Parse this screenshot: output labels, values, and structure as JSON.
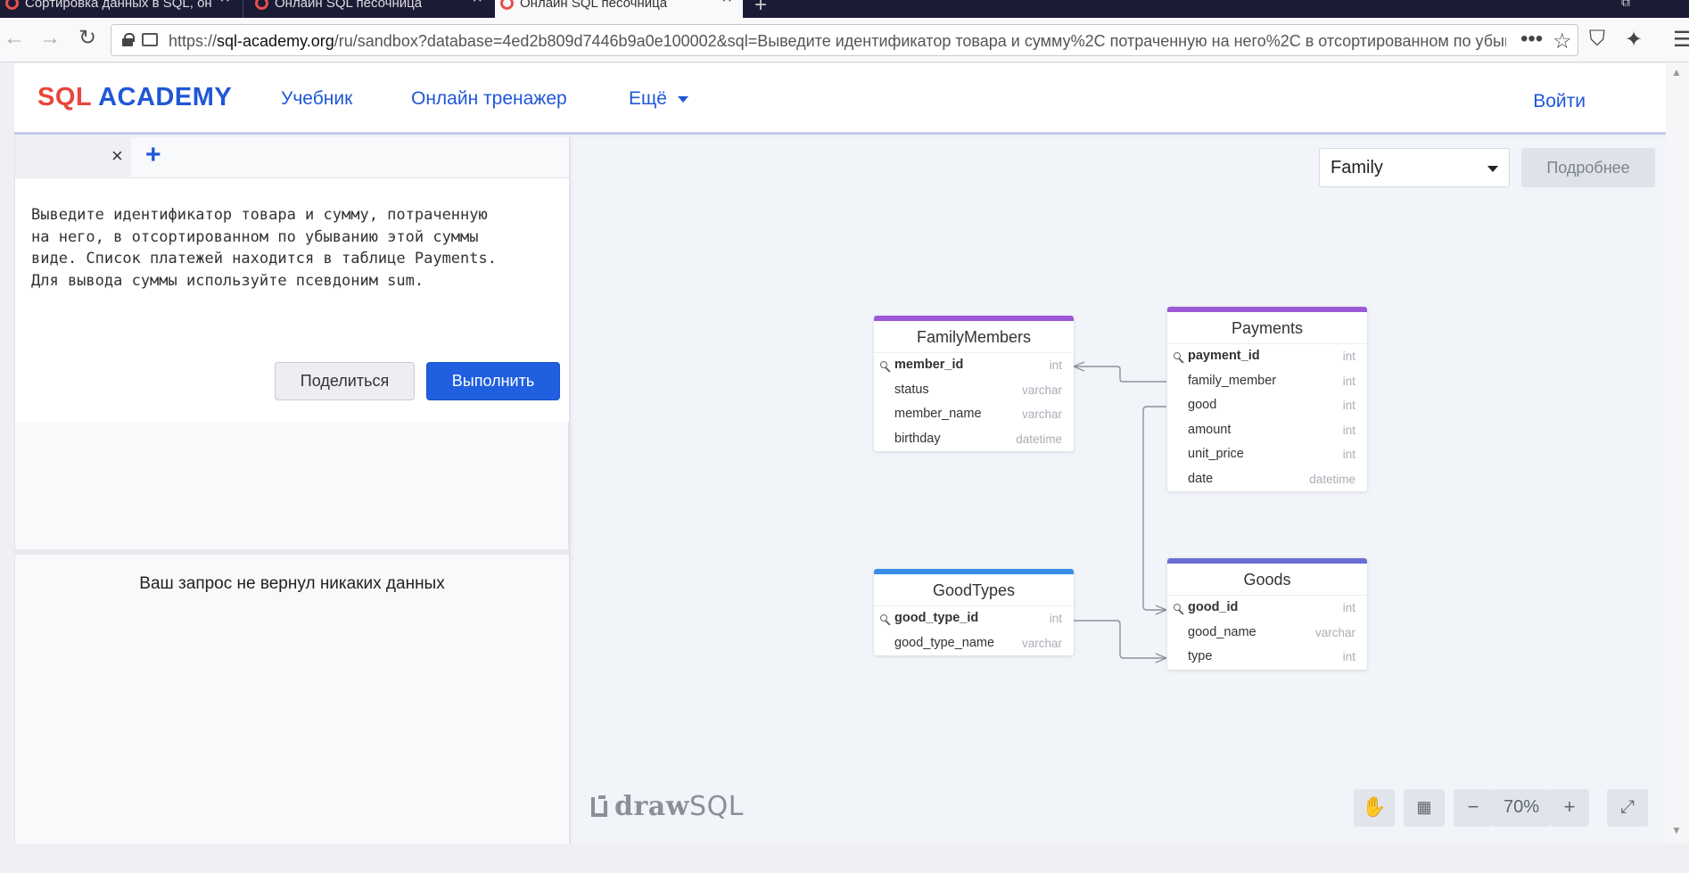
{
  "browser": {
    "tabs": [
      {
        "title": "Сортировка данных в SQL, он"
      },
      {
        "title": "Онлайн SQL песочница"
      },
      {
        "title": "Онлайн SQL песочница"
      }
    ],
    "url_prefix": "https://",
    "url_domain": "sql-academy.org",
    "url_rest": "/ru/sandbox?database=4ed2b809d7446b9a0e100002&sql=Выведите идентификатор товара и сумму%2C потраченную на него%2C в отсортированном по убыванию эт"
  },
  "site": {
    "logo_sql": "SQL",
    "logo_academy": "ACADEMY",
    "menu": {
      "tutorial": "Учебник",
      "trainer": "Онлайн тренажер",
      "more": "Ещё"
    },
    "login": "Войти"
  },
  "editor": {
    "text": "Выведите идентификатор товара и сумму, потраченную\nна него, в отсортированном по убыванию этой суммы\nвиде. Список платежей находится в таблице Payments.\nДля вывода суммы используйте псевдоним sum.",
    "share_label": "Поделиться",
    "run_label": "Выполнить"
  },
  "results": {
    "message": "Ваш запрос не вернул никаких данных"
  },
  "diagram": {
    "database": "Family",
    "more_label": "Подробнее",
    "zoom": "70%",
    "brand_draw": "draw",
    "brand_sql": "SQL",
    "tables": {
      "family_members": {
        "name": "FamilyMembers",
        "color": "#9b59d6",
        "columns": [
          {
            "name": "member_id",
            "type": "int",
            "pk": true
          },
          {
            "name": "status",
            "type": "varchar"
          },
          {
            "name": "member_name",
            "type": "varchar"
          },
          {
            "name": "birthday",
            "type": "datetime"
          }
        ]
      },
      "payments": {
        "name": "Payments",
        "color": "#9b59d6",
        "columns": [
          {
            "name": "payment_id",
            "type": "int",
            "pk": true
          },
          {
            "name": "family_member",
            "type": "int"
          },
          {
            "name": "good",
            "type": "int"
          },
          {
            "name": "amount",
            "type": "int"
          },
          {
            "name": "unit_price",
            "type": "int"
          },
          {
            "name": "date",
            "type": "datetime"
          }
        ]
      },
      "good_types": {
        "name": "GoodTypes",
        "color": "#3b8ee6",
        "columns": [
          {
            "name": "good_type_id",
            "type": "int",
            "pk": true
          },
          {
            "name": "good_type_name",
            "type": "varchar"
          }
        ]
      },
      "goods": {
        "name": "Goods",
        "color": "#6a6fd6",
        "columns": [
          {
            "name": "good_id",
            "type": "int",
            "pk": true
          },
          {
            "name": "good_name",
            "type": "varchar"
          },
          {
            "name": "type",
            "type": "int"
          }
        ]
      }
    }
  }
}
